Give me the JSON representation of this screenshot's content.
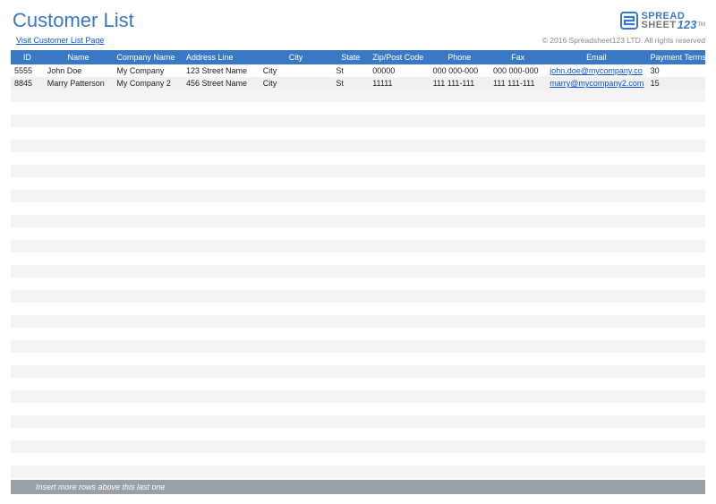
{
  "header": {
    "title": "Customer List",
    "visit_link": "Visit Customer List Page",
    "copyright": "© 2016 Spreadsheet123 LTD. All rights reserved",
    "logo_text_a": "SPREAD",
    "logo_text_b": "SHEET",
    "logo_text_c": "123",
    "logo_tm": "TM"
  },
  "columns": {
    "id": "ID",
    "name": "Name",
    "company": "Company Name",
    "address": "Address Line",
    "city": "City",
    "state": "State",
    "zip": "Zip/Post Code",
    "phone": "Phone",
    "fax": "Fax",
    "email": "Email",
    "terms": "Payment Terms"
  },
  "rows": [
    {
      "id": "5555",
      "name": "John Doe",
      "company": "My Company",
      "address": "123 Street Name",
      "city": "City",
      "state": "St",
      "zip": "00000",
      "phone": "000 000-000",
      "fax": "000 000-000",
      "email": "john.doe@mycompany.co",
      "terms": "30"
    },
    {
      "id": "8845",
      "name": "Marry Patterson",
      "company": "My Company 2",
      "address": "456 Street Name",
      "city": "City",
      "state": "St",
      "zip": "11111",
      "phone": "111 111-111",
      "fax": "111 111-111",
      "email": "marry@mycompany2.com",
      "terms": "15"
    }
  ],
  "empty_rows": 31,
  "footer": {
    "note": "Insert more rows above this last one"
  }
}
